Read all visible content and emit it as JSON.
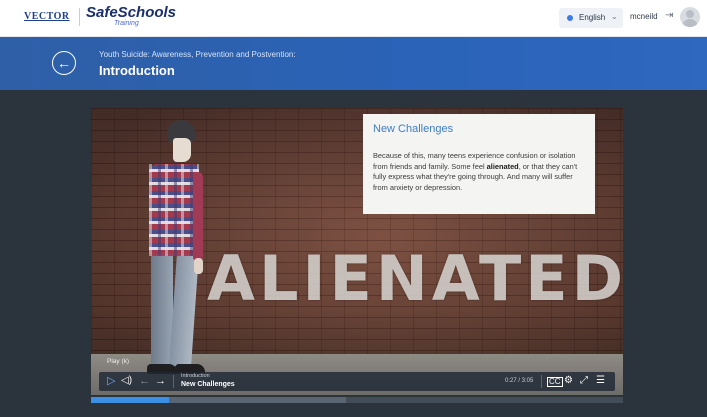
{
  "header": {
    "logo_vector": "VECTOR",
    "logo_main": "SafeSchools",
    "logo_sub": "Training",
    "language": "English",
    "username": "mcneild"
  },
  "banner": {
    "subtitle": "Youth Suicide: Awareness, Prevention and Postvention:",
    "title": "Introduction"
  },
  "slide": {
    "title": "New Challenges",
    "body_pre": "Because of this, many teens experience confusion or isolation from friends and family. Some feel ",
    "body_bold": "alienated",
    "body_post": ", or that they can't fully express what they're going through. And many will suffer from anxiety or depression.",
    "big_word": "ALIENATED"
  },
  "player": {
    "tooltip": "Play (k)",
    "lesson": "Introduction",
    "slide_name": "New Challenges",
    "time": "0:27 / 3:05",
    "progress_fraction": 0.146,
    "buffer_fraction": 0.48
  },
  "icons": {
    "back": "arrow-left-icon",
    "language": "globe-dot-icon",
    "logout": "logout-icon",
    "play": "play-icon",
    "volume": "volume-icon",
    "prev": "arrow-left-icon",
    "next": "arrow-right-icon",
    "cc": "closed-captions-icon",
    "settings": "gear-icon",
    "fullscreen": "fullscreen-icon",
    "menu": "menu-list-icon"
  },
  "colors": {
    "banner": "#2a63b8",
    "accent": "#3d8fe4",
    "page_bg": "#2b333c"
  }
}
